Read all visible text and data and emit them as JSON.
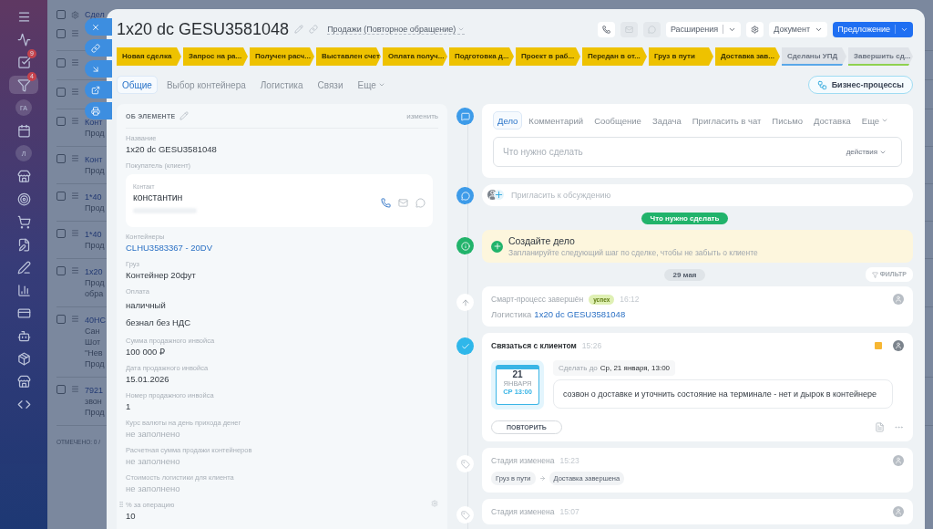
{
  "app_sidebar": {
    "items": [
      {
        "kind": "menu"
      },
      {
        "kind": "feed"
      },
      {
        "kind": "tasks",
        "badge": "9"
      },
      {
        "kind": "crm",
        "badge": "4",
        "selected": true
      },
      {
        "kind": "avatar",
        "label": "ГА"
      },
      {
        "kind": "calendar"
      },
      {
        "kind": "avatar",
        "label": "Л"
      },
      {
        "kind": "store"
      },
      {
        "kind": "target"
      },
      {
        "kind": "cart"
      },
      {
        "kind": "doc"
      },
      {
        "kind": "sign"
      },
      {
        "kind": "chart"
      },
      {
        "kind": "card"
      },
      {
        "kind": "robot"
      },
      {
        "kind": "box"
      },
      {
        "kind": "market"
      },
      {
        "kind": "code"
      }
    ]
  },
  "background_list": {
    "header": "Сдел",
    "header_checked": false,
    "rows": [
      {
        "checked": false,
        "lines": []
      },
      {
        "checked": false,
        "lines": []
      },
      {
        "checked": false,
        "lines": []
      },
      {
        "checked": false,
        "lines": [
          "Конт",
          "Прод"
        ]
      },
      {
        "checked": false,
        "lines": [
          "Конт",
          "Прод"
        ]
      },
      {
        "checked": false,
        "lines": [
          "1*40",
          "Прод"
        ]
      },
      {
        "checked": false,
        "lines": [
          "1*40",
          "Прод"
        ]
      },
      {
        "checked": false,
        "lines": [
          "1x20",
          "Прод",
          "обра"
        ]
      },
      {
        "checked": false,
        "lines": [
          "40НС",
          "Сан",
          "Шот",
          "\"Нев",
          "Прод"
        ]
      },
      {
        "checked": false,
        "lines": [
          "7921",
          "звон",
          "Прод"
        ]
      }
    ],
    "footer": "ОТМЕЧЕНО: 0 /"
  },
  "side_actions": [
    {
      "kind": "close"
    },
    {
      "kind": "link"
    },
    {
      "kind": "collapse"
    },
    {
      "kind": "open"
    },
    {
      "kind": "print"
    }
  ],
  "header": {
    "title": "1x20 dc GESU3581048",
    "category": "Продажи (Повторное обращение)",
    "contact_buttons": [
      {
        "kind": "phone",
        "disabled": false
      },
      {
        "kind": "mail",
        "disabled": true
      },
      {
        "kind": "chat",
        "disabled": true
      }
    ],
    "extensions_button": "Расширения",
    "document_button": "Документ",
    "primary_button": "Предложение"
  },
  "stages": [
    {
      "label": "Новая сделка",
      "passed": true
    },
    {
      "label": "Запрос на ра...",
      "passed": true
    },
    {
      "label": "Получен расч...",
      "passed": true
    },
    {
      "label": "Выставлен счет",
      "passed": true
    },
    {
      "label": "Оплата получ...",
      "passed": true
    },
    {
      "label": "Подготовка д...",
      "passed": true
    },
    {
      "label": "Проект в раб...",
      "passed": true
    },
    {
      "label": "Передан в от...",
      "passed": true
    },
    {
      "label": "Груз в пути",
      "passed": true
    },
    {
      "label": "Доставка зав...",
      "passed": true
    },
    {
      "label": "Сделаны УПД",
      "passed": false,
      "color": "#5aa7e8"
    },
    {
      "label": "Завершить сд...",
      "passed": false,
      "color": "#8fd14f"
    }
  ],
  "tabs": [
    {
      "label": "Общие",
      "selected": true
    },
    {
      "label": "Выбор контейнера",
      "selected": false
    },
    {
      "label": "Логистика",
      "selected": false
    },
    {
      "label": "Связи",
      "selected": false
    },
    {
      "label": "Еще",
      "selected": false,
      "dropdown": true
    }
  ],
  "business_processes_button": "Бизнес-процессы",
  "details": {
    "title": "ОБ ЭЛЕМЕНТЕ",
    "edit_link": "изменить",
    "fields": [
      {
        "kind": "text",
        "label": "Название",
        "values": [
          "1x20 dc GESU3581048"
        ]
      },
      {
        "kind": "client",
        "label": "Покупатель (клиент)",
        "contact_label": "Контакт",
        "contact_name": "константин"
      },
      {
        "kind": "link",
        "label": "Контейнеры",
        "values": [
          "CLHU3583367 - 20DV"
        ]
      },
      {
        "kind": "text",
        "label": "Груз",
        "values": [
          "Контейнер 20фут"
        ]
      },
      {
        "kind": "text",
        "label": "Оплата",
        "values": [
          "наличный",
          "безнал без НДС"
        ]
      },
      {
        "kind": "text",
        "label": "Сумма продажного инвойса",
        "values": [
          "100 000 ₽"
        ]
      },
      {
        "kind": "text",
        "label": "Дата продажного инвойса",
        "values": [
          "15.01.2026"
        ]
      },
      {
        "kind": "text",
        "label": "Номер продажного инвойса",
        "values": [
          "1"
        ]
      },
      {
        "kind": "empty",
        "label": "Курс валюты на день прихода денег",
        "values": [
          "не заполнено"
        ]
      },
      {
        "kind": "empty",
        "label": "Расчетная сумма продажи контейнеров",
        "values": [
          "не заполнено"
        ]
      },
      {
        "kind": "empty",
        "label": "Стоимость логистики для клиента",
        "values": [
          "не заполнено"
        ]
      },
      {
        "kind": "text",
        "label": "% за операцию",
        "values": [
          "10"
        ],
        "hovered": true
      }
    ]
  },
  "composer": {
    "tabs": [
      {
        "label": "Дело",
        "selected": true
      },
      {
        "label": "Комментарий",
        "selected": false
      },
      {
        "label": "Сообщение",
        "selected": false
      },
      {
        "label": "Задача",
        "selected": false
      },
      {
        "label": "Пригласить в чат",
        "selected": false
      },
      {
        "label": "Письмо",
        "selected": false
      },
      {
        "label": "Доставка",
        "selected": false
      },
      {
        "label": "Еще",
        "selected": false,
        "dropdown": true
      }
    ],
    "placeholder": "Что нужно сделать",
    "actions": "действия"
  },
  "invite": {
    "placeholder": "Пригласить к обсуждению"
  },
  "todo_badge": "Что нужно сделать",
  "hint": {
    "title": "Создайте дело",
    "text": "Запланируйте следующий шаг по сделке, чтобы не забыть о клиенте"
  },
  "date_pill": "29 мая",
  "filter_button": "ФИЛЬТР",
  "timeline": [
    {
      "kind": "smart_process",
      "title": "Смарт-процесс завершён",
      "badge": "успех",
      "time": "16:12",
      "entity": "Логистика",
      "link": "1x20 dc GESU3581048"
    },
    {
      "kind": "activity",
      "title": "Связаться с клиентом",
      "time": "15:26",
      "color": "#f7b733",
      "calendar": {
        "day": "21",
        "month": "ЯНВАРЯ",
        "weekday_time": "СР 13:00"
      },
      "deadline_label": "Сделать до",
      "deadline": "Ср, 21 января, 13:00",
      "text": "созвон о доставке и уточнить состояние на терминале - нет и дырок в контейнере",
      "button": "ПОВТОРИТЬ"
    },
    {
      "kind": "stage_change",
      "title": "Стадия изменена",
      "time": "15:23",
      "from": "Груз в пути",
      "to": "Доставка завершена"
    },
    {
      "kind": "stage_change",
      "title": "Стадия изменена",
      "time": "15:07"
    }
  ]
}
